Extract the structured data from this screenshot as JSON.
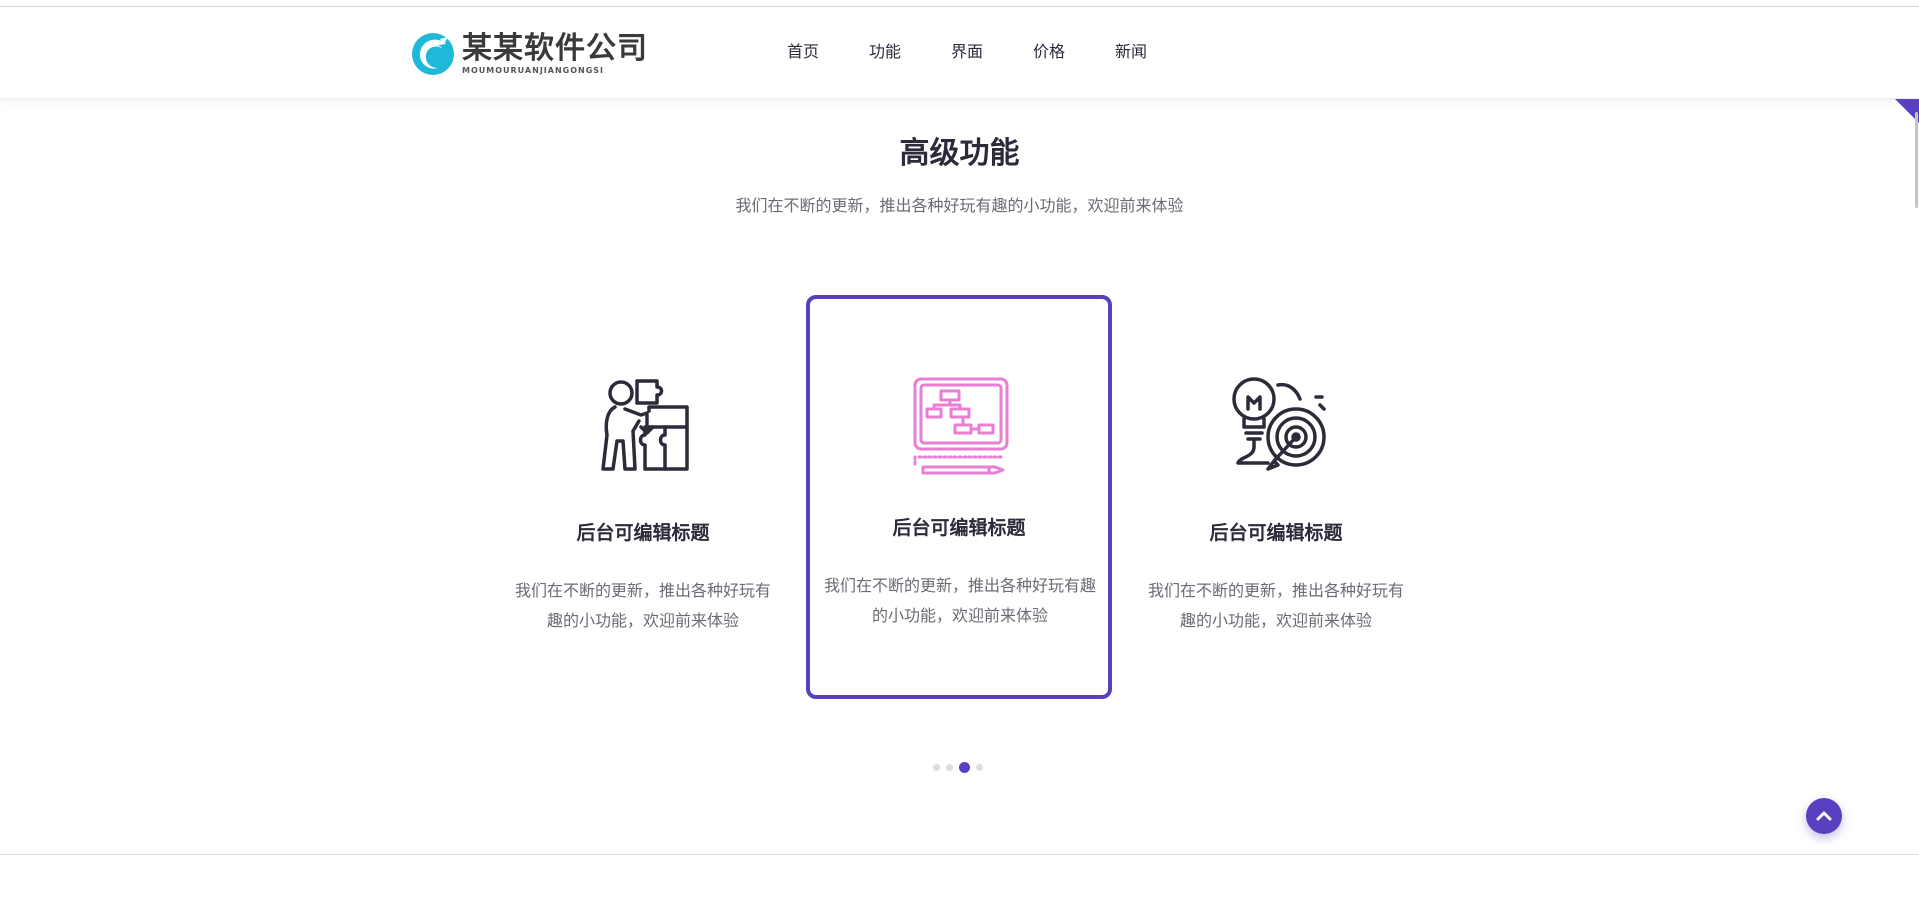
{
  "brand": {
    "name_cn": "某某软件公司",
    "name_en": "MOUMOURUANJIANGONGSI",
    "logo_icon": "swirl-logo-icon",
    "logo_color": "#1fb8d8"
  },
  "nav": {
    "items": [
      {
        "label": "首页"
      },
      {
        "label": "功能"
      },
      {
        "label": "界面"
      },
      {
        "label": "价格"
      },
      {
        "label": "新闻"
      }
    ]
  },
  "section": {
    "title": "高级功能",
    "subtitle": "我们在不断的更新，推出各种好玩有趣的小功能，欢迎前来体验"
  },
  "cards": [
    {
      "icon": "puzzle-person-icon",
      "title": "后台可编辑标题",
      "desc": "我们在不断的更新，推出各种好玩有趣的小功能，欢迎前来体验",
      "active": false
    },
    {
      "icon": "tablet-flowchart-icon",
      "title": "后台可编辑标题",
      "desc": "我们在不断的更新，推出各种好玩有趣的小功能，欢迎前来体验",
      "active": true
    },
    {
      "icon": "lightbulb-target-icon",
      "title": "后台可编辑标题",
      "desc": "我们在不断的更新，推出各种好玩有趣的小功能，欢迎前来体验",
      "active": false
    }
  ],
  "carousel": {
    "total_dots": 4,
    "active_index": 2
  },
  "back_to_top": {
    "icon": "chevron-up-icon"
  },
  "colors": {
    "accent": "#5a3fc0",
    "icon_dark": "#2b2b3a",
    "icon_pink": "#e77fd5",
    "text_muted": "#6b6b75"
  }
}
